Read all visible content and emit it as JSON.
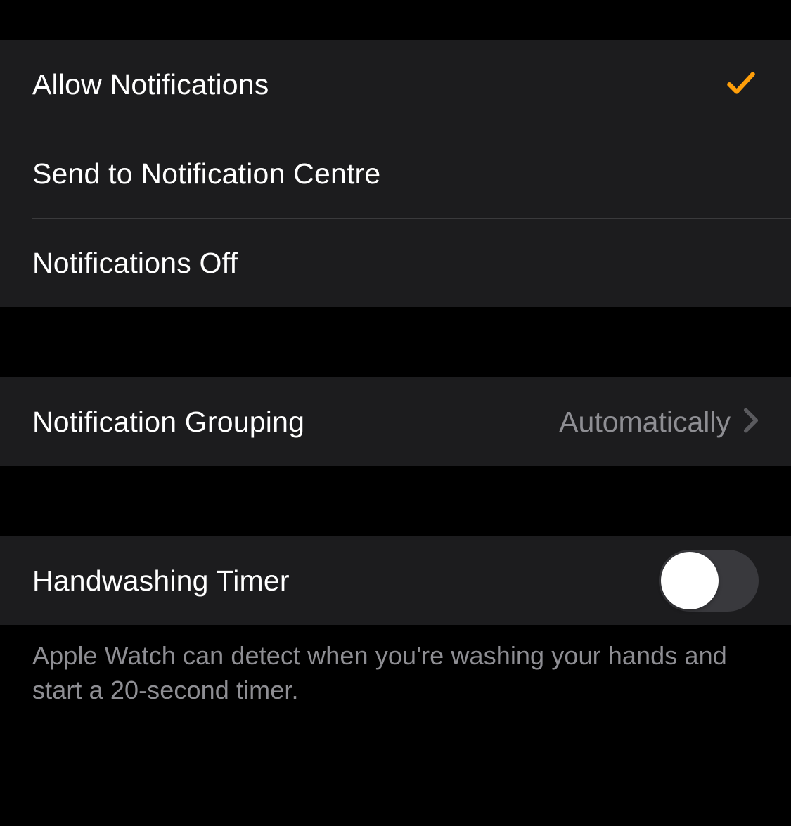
{
  "notification_options": {
    "allow": {
      "label": "Allow Notifications",
      "selected": true
    },
    "send_to_centre": {
      "label": "Send to Notification Centre",
      "selected": false
    },
    "off": {
      "label": "Notifications Off",
      "selected": false
    }
  },
  "grouping": {
    "label": "Notification Grouping",
    "value": "Automatically"
  },
  "handwashing": {
    "label": "Handwashing Timer",
    "enabled": false,
    "footer": "Apple Watch can detect when you're washing your hands and start a 20-second timer."
  }
}
